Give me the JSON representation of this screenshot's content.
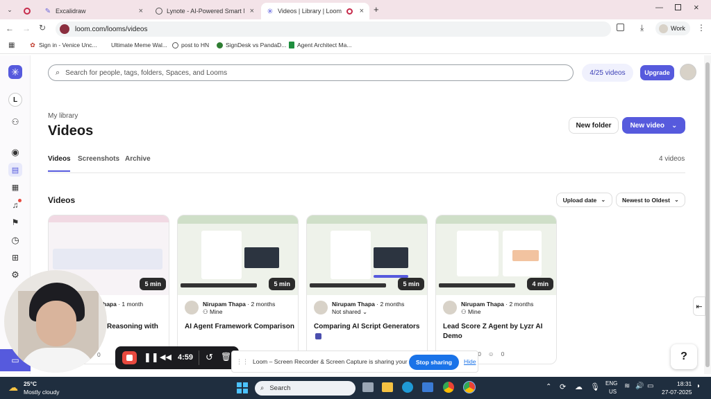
{
  "browser": {
    "tabs": [
      {
        "title": "",
        "icon": "record-icon",
        "active": false
      },
      {
        "title": "Excalidraw",
        "icon": "excalidraw-icon",
        "active": false
      },
      {
        "title": "Lynote - AI-Powered Smart Not",
        "icon": "globe-icon",
        "active": false
      },
      {
        "title": "Videos | Library | Loom",
        "icon": "loom-icon",
        "active": true
      }
    ],
    "url": "loom.com/looms/videos",
    "profile_label": "Work",
    "bookmarks": [
      {
        "label": "Sign in - Venice Unc..."
      },
      {
        "label": "Ultimate Meme Wal..."
      },
      {
        "label": "post to HN"
      },
      {
        "label": "SignDesk vs PandaD..."
      },
      {
        "label": "Agent Architect Ma..."
      }
    ]
  },
  "sidebar": {
    "workspace_initial": "L"
  },
  "header": {
    "search_placeholder": "Search for people, tags, folders, Spaces, and Looms",
    "video_quota": "4/25 videos",
    "upgrade_label": "Upgrade"
  },
  "library": {
    "breadcrumb": "My library",
    "title": "Videos",
    "new_folder_label": "New folder",
    "new_video_label": "New video",
    "tabs": [
      "Videos",
      "Screenshots",
      "Archive"
    ],
    "active_tab": "Videos",
    "count": "4 videos",
    "section_title": "Videos",
    "sort_field": "Upload date",
    "sort_order": "Newest to Oldest"
  },
  "videos": [
    {
      "duration": "5 min",
      "author": "hapa",
      "age": "1 month",
      "title": "Reasoning with",
      "stat_visible": "0"
    },
    {
      "duration": "5 min",
      "author": "Nirupam Thapa",
      "age": "2 months",
      "sharing": "Mine",
      "title": "AI Agent Framework Comparison"
    },
    {
      "duration": "5 min",
      "author": "Nirupam Thapa",
      "age": "2 months",
      "sharing": "Not shared",
      "title": "Comparing AI Script Generators",
      "stats": [
        "0",
        "0",
        "0"
      ]
    },
    {
      "duration": "4 min",
      "author": "Nirupam Thapa",
      "age": "2 months",
      "sharing": "Mine",
      "title": "Lead Score Z Agent by Lyzr AI Demo",
      "stats": [
        "0",
        "0",
        "0"
      ]
    }
  ],
  "recorder": {
    "timer": "4:59",
    "share_text": "Loom – Screen Recorder & Screen Capture is sharing your screen.",
    "stop_label": "Stop sharing",
    "hide_label": "Hide"
  },
  "help_label": "?",
  "taskbar": {
    "temperature": "25°C",
    "weather": "Mostly cloudy",
    "search_label": "Search",
    "lang_top": "ENG",
    "lang_bottom": "US",
    "time": "18:31",
    "date": "27-07-2025"
  },
  "colors": {
    "loom_purple": "#565ADD",
    "tab_strip": "#f3e3e8",
    "taskbar": "#1f2e3f",
    "stop_blue": "#1a73e8",
    "record_red": "#e8493f"
  }
}
